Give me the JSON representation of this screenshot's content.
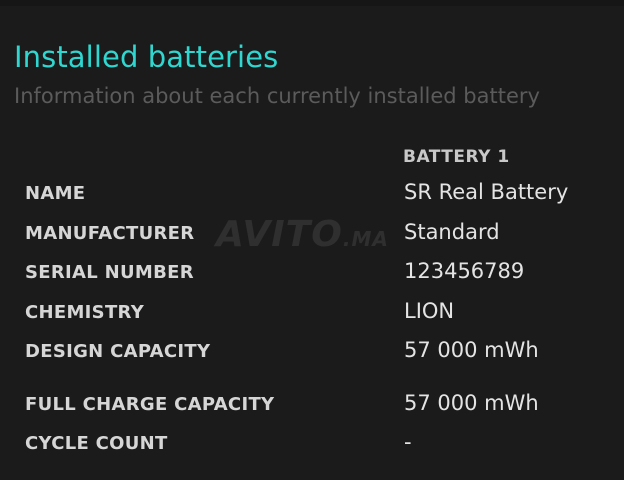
{
  "header": {
    "title": "Installed batteries",
    "subtitle": "Information about each currently installed battery"
  },
  "table": {
    "column_header": "BATTERY 1",
    "rows": [
      {
        "label": "NAME",
        "value": "SR Real Battery"
      },
      {
        "label": "MANUFACTURER",
        "value": "Standard"
      },
      {
        "label": "SERIAL NUMBER",
        "value": "123456789"
      },
      {
        "label": "CHEMISTRY",
        "value": "LION"
      },
      {
        "label": "DESIGN CAPACITY",
        "value": "57 000 mWh"
      },
      {
        "label": "FULL CHARGE CAPACITY",
        "value": "57 000 mWh"
      },
      {
        "label": "CYCLE COUNT",
        "value": "-"
      }
    ]
  },
  "watermark": {
    "text": "AVITO",
    "suffix": ".MA"
  },
  "colors": {
    "background": "#1b1b1b",
    "title": "#2fd7d0",
    "subtitle": "#5b5b5b",
    "label": "#d6d6d6",
    "value": "#e4e4e4"
  }
}
